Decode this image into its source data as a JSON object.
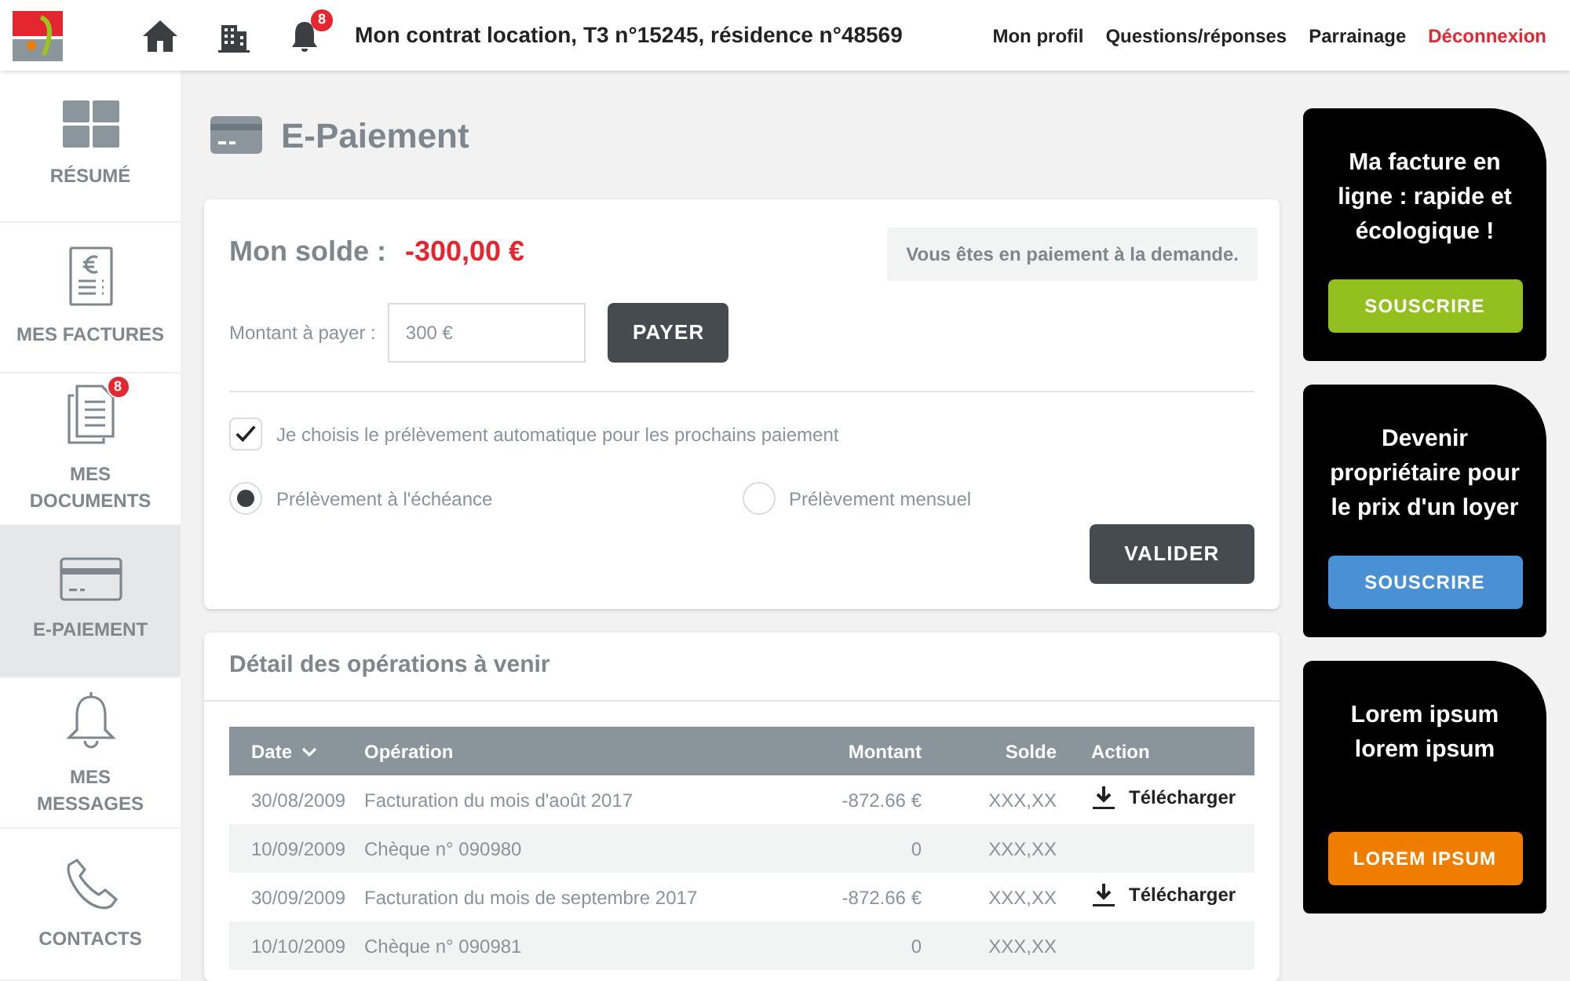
{
  "header": {
    "nav_icons": [
      {
        "kind": "home"
      },
      {
        "kind": "building"
      },
      {
        "kind": "bell",
        "badge": "8"
      }
    ],
    "contract_title": "Mon contrat location, T3 n°15245, résidence n°48569",
    "links": [
      {
        "label": "Mon profil",
        "kind": "normal"
      },
      {
        "label": "Questions/réponses",
        "kind": "normal"
      },
      {
        "label": "Parrainage",
        "kind": "normal"
      },
      {
        "label": "Déconnexion",
        "kind": "logout"
      }
    ]
  },
  "sidebar": {
    "items": [
      {
        "label": "RÉSUMÉ",
        "kind": "grid",
        "selected": false
      },
      {
        "label": "MES FACTURES",
        "kind": "invoice",
        "selected": false
      },
      {
        "label": "MES DOCUMENTS",
        "kind": "documents",
        "badge": "8",
        "selected": false
      },
      {
        "label": "E-PAIEMENT",
        "kind": "card",
        "selected": true
      },
      {
        "label": "MES MESSAGES",
        "kind": "bell",
        "selected": false
      },
      {
        "label": "CONTACTS",
        "kind": "phone",
        "selected": false
      }
    ]
  },
  "page_title": "E-Paiement",
  "payment": {
    "balance_label": "Mon solde :",
    "balance": "-300,00 €",
    "notice": "Vous êtes en paiement à la demande.",
    "amount_label": "Montant à payer :",
    "amount_value": "300 €",
    "pay_button": "PAYER",
    "auto_debit": {
      "label": "Je choisis le prélèvement automatique pour les prochains paiement",
      "checked": true
    },
    "options": [
      {
        "label": "Prélèvement à l'échéance",
        "selected": true
      },
      {
        "label": "Prélèvement mensuel",
        "selected": false
      }
    ],
    "validate_button": "VALIDER"
  },
  "operations": {
    "title": "Détail des opérations à venir",
    "columns": [
      "Date",
      "Opération",
      "Montant",
      "Solde",
      "Action"
    ],
    "rows": [
      {
        "date": "30/08/2009",
        "operation": "Facturation du mois d'août 2017",
        "amount": "-872.66 €",
        "balance": "XXX,XX",
        "action": "Télécharger"
      },
      {
        "date": "10/09/2009",
        "operation": "Chèque n° 090980",
        "amount": "0",
        "balance": "XXX,XX"
      },
      {
        "date": "30/09/2009",
        "operation": "Facturation du mois de septembre 2017",
        "amount": "-872.66 €",
        "balance": "XXX,XX",
        "action": "Télécharger"
      },
      {
        "date": "10/10/2009",
        "operation": "Chèque n° 090981",
        "amount": "0",
        "balance": "XXX,XX"
      }
    ]
  },
  "promos": [
    {
      "text": "Ma facture en ligne : rapide et écologique !",
      "button": "SOUSCRIRE",
      "color": "#93c01f"
    },
    {
      "text": "Devenir propriétaire pour le prix d'un loyer",
      "button": "SOUSCRIRE",
      "color": "#4a90d4"
    },
    {
      "text": "Lorem ipsum lorem ipsum",
      "button": "LOREM IPSUM",
      "color": "#ef7d00"
    }
  ]
}
